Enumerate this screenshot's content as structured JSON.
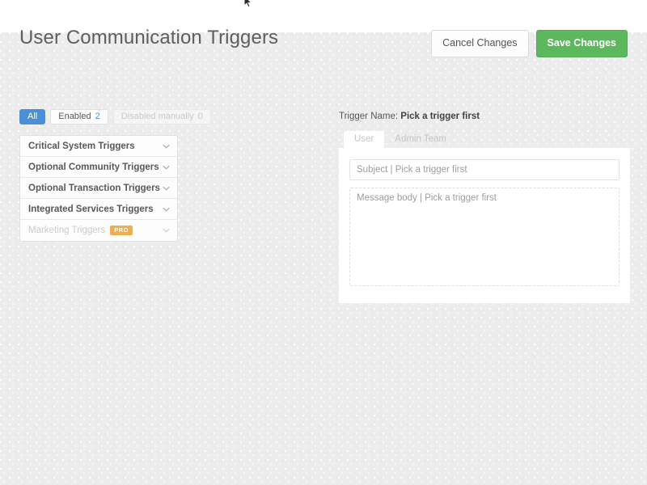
{
  "header": {
    "title": "User Communication Triggers",
    "cancel_label": "Cancel Changes",
    "save_label": "Save Changes",
    "accent_green": "#5cb85c",
    "accent_blue": "#4a90d9"
  },
  "filters": [
    {
      "label": "All",
      "count": "",
      "state": "active"
    },
    {
      "label": "Enabled",
      "count": "2",
      "state": "default"
    },
    {
      "label": "Disabled manually",
      "count": "0",
      "state": "muted"
    }
  ],
  "accordion": [
    {
      "label": "Critical System Triggers",
      "badge": "",
      "disabled": false
    },
    {
      "label": "Optional Community Triggers",
      "badge": "",
      "disabled": false
    },
    {
      "label": "Optional Transaction Triggers",
      "badge": "",
      "disabled": false
    },
    {
      "label": "Integrated Services Triggers",
      "badge": "",
      "disabled": false
    },
    {
      "label": "Marketing Triggers",
      "badge": "PRO",
      "disabled": true
    }
  ],
  "detail": {
    "trigger_name_label": "Trigger Name:",
    "trigger_name_value": "Pick a trigger first",
    "tabs": [
      {
        "label": "User",
        "active": true
      },
      {
        "label": "Admin Team",
        "active": false
      }
    ],
    "subject_placeholder": "Subject | Pick a trigger first",
    "subject_value": "",
    "body_placeholder": "Message body | Pick a trigger first",
    "body_value": ""
  },
  "badge_colors": {
    "pro": "#f0ad4e"
  }
}
